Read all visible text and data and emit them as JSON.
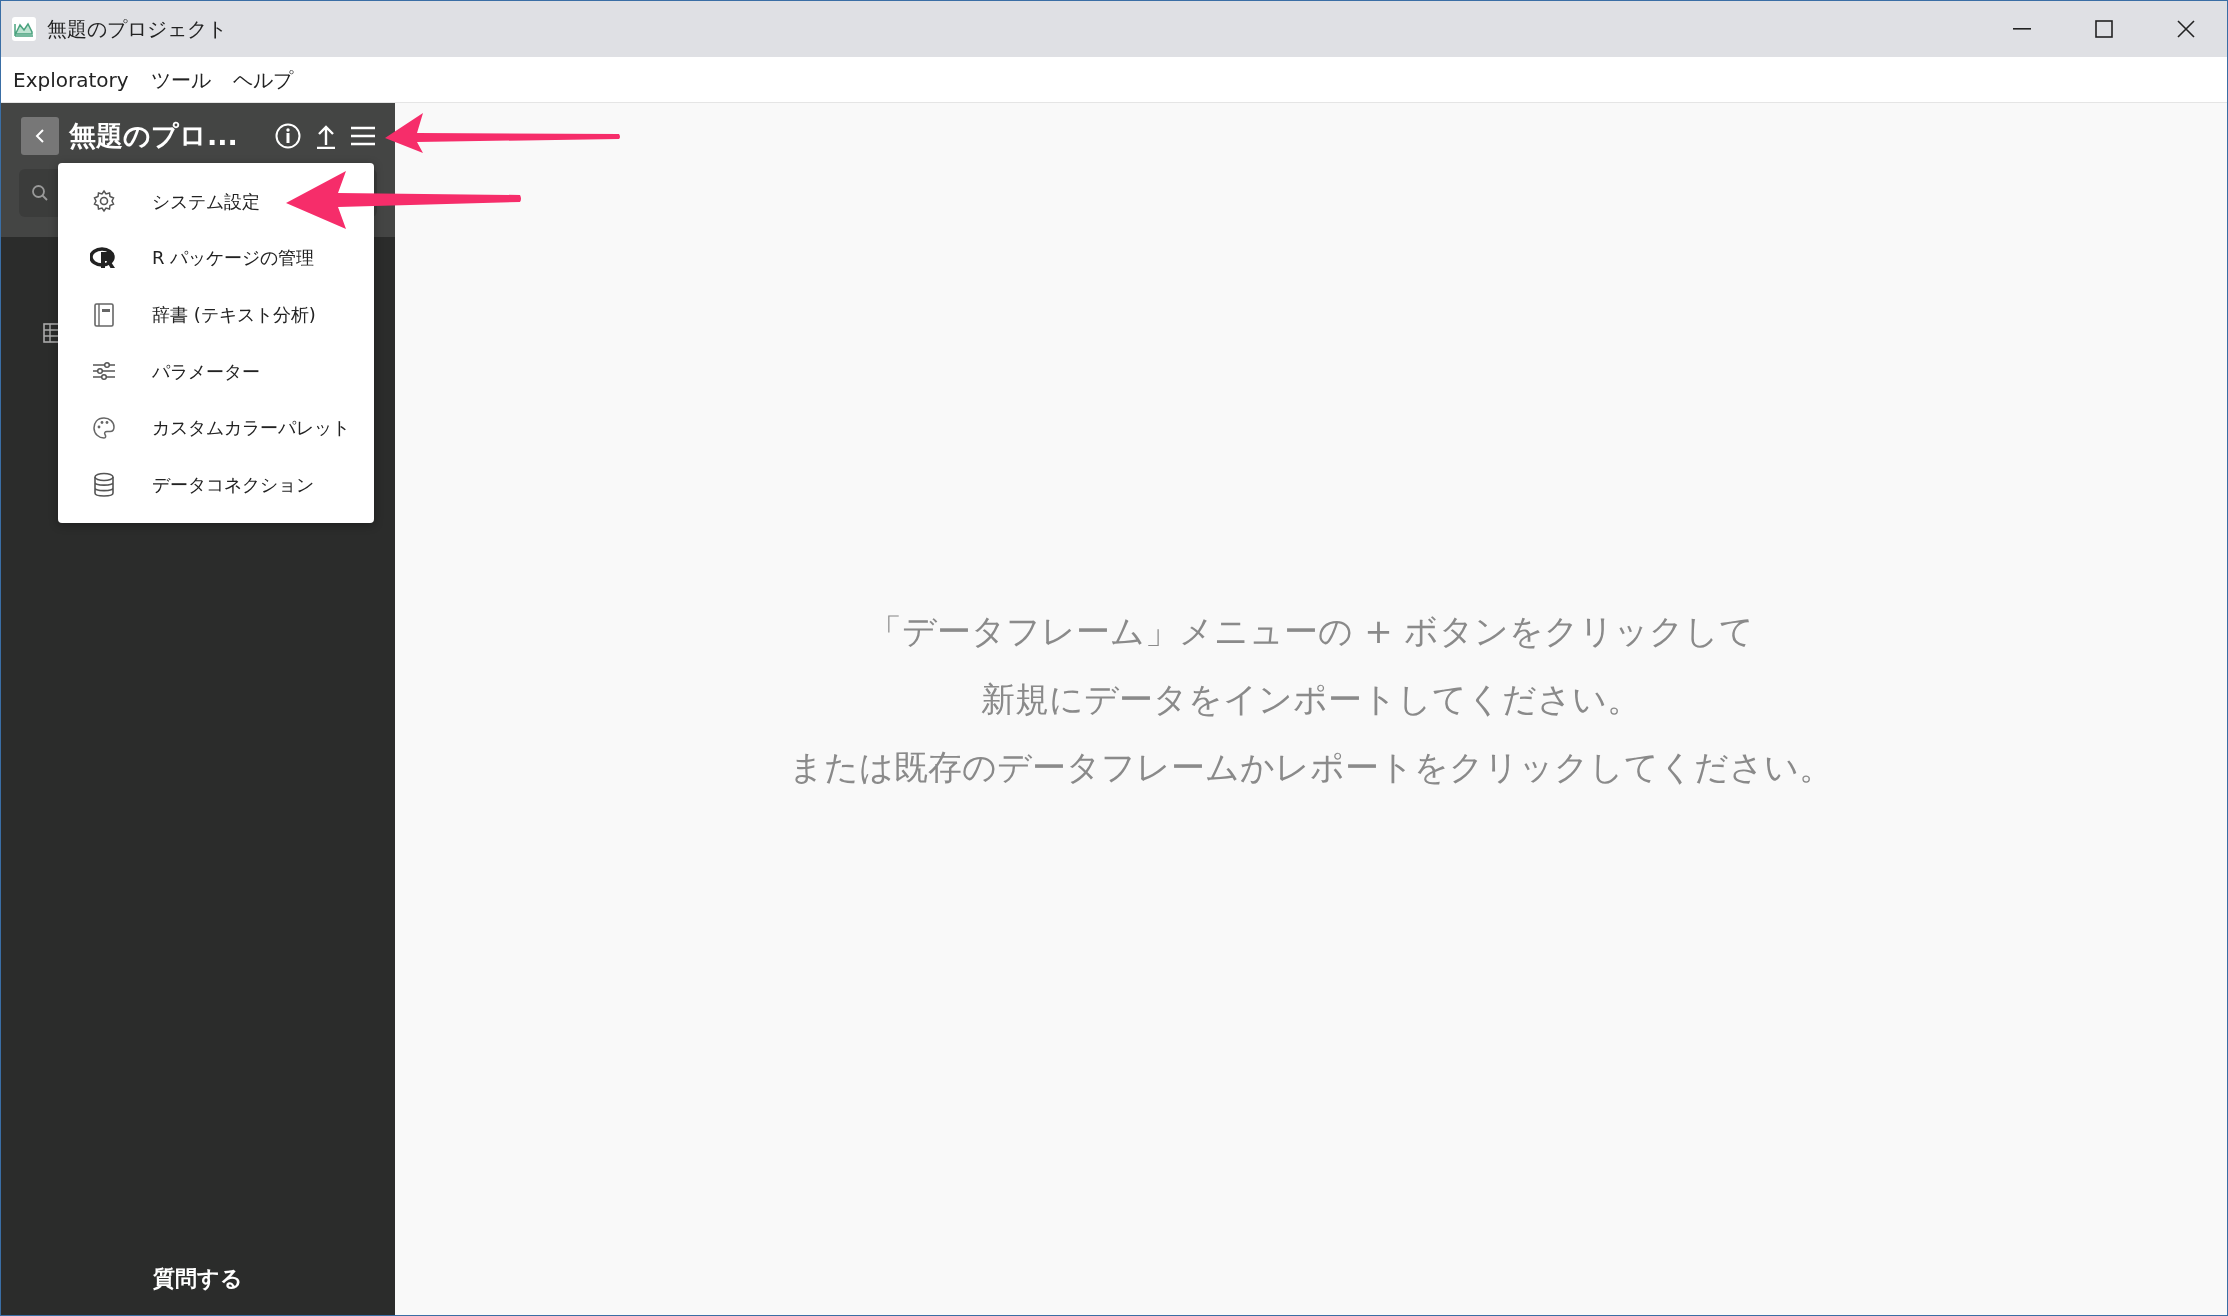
{
  "window": {
    "title": "無題のプロジェクト"
  },
  "menu_bar": [
    "Exploratory",
    "ツール",
    "ヘルプ"
  ],
  "sidebar": {
    "project_title": "無題のプロ...",
    "footer": "質問する"
  },
  "dropdown_menu": [
    {
      "kind": "gear",
      "label": "システム設定"
    },
    {
      "kind": "r",
      "label": "R パッケージの管理"
    },
    {
      "kind": "book",
      "label": "辞書 (テキスト分析)"
    },
    {
      "kind": "sliders",
      "label": "パラメーター"
    },
    {
      "kind": "palette",
      "label": "カスタムカラーパレット"
    },
    {
      "kind": "database",
      "label": "データコネクション"
    }
  ],
  "empty_state": [
    "「データフレーム」メニューの + ボタンをクリックして",
    "新規にデータをインポートしてください。",
    "または既存のデータフレームかレポートをクリックしてください。"
  ]
}
